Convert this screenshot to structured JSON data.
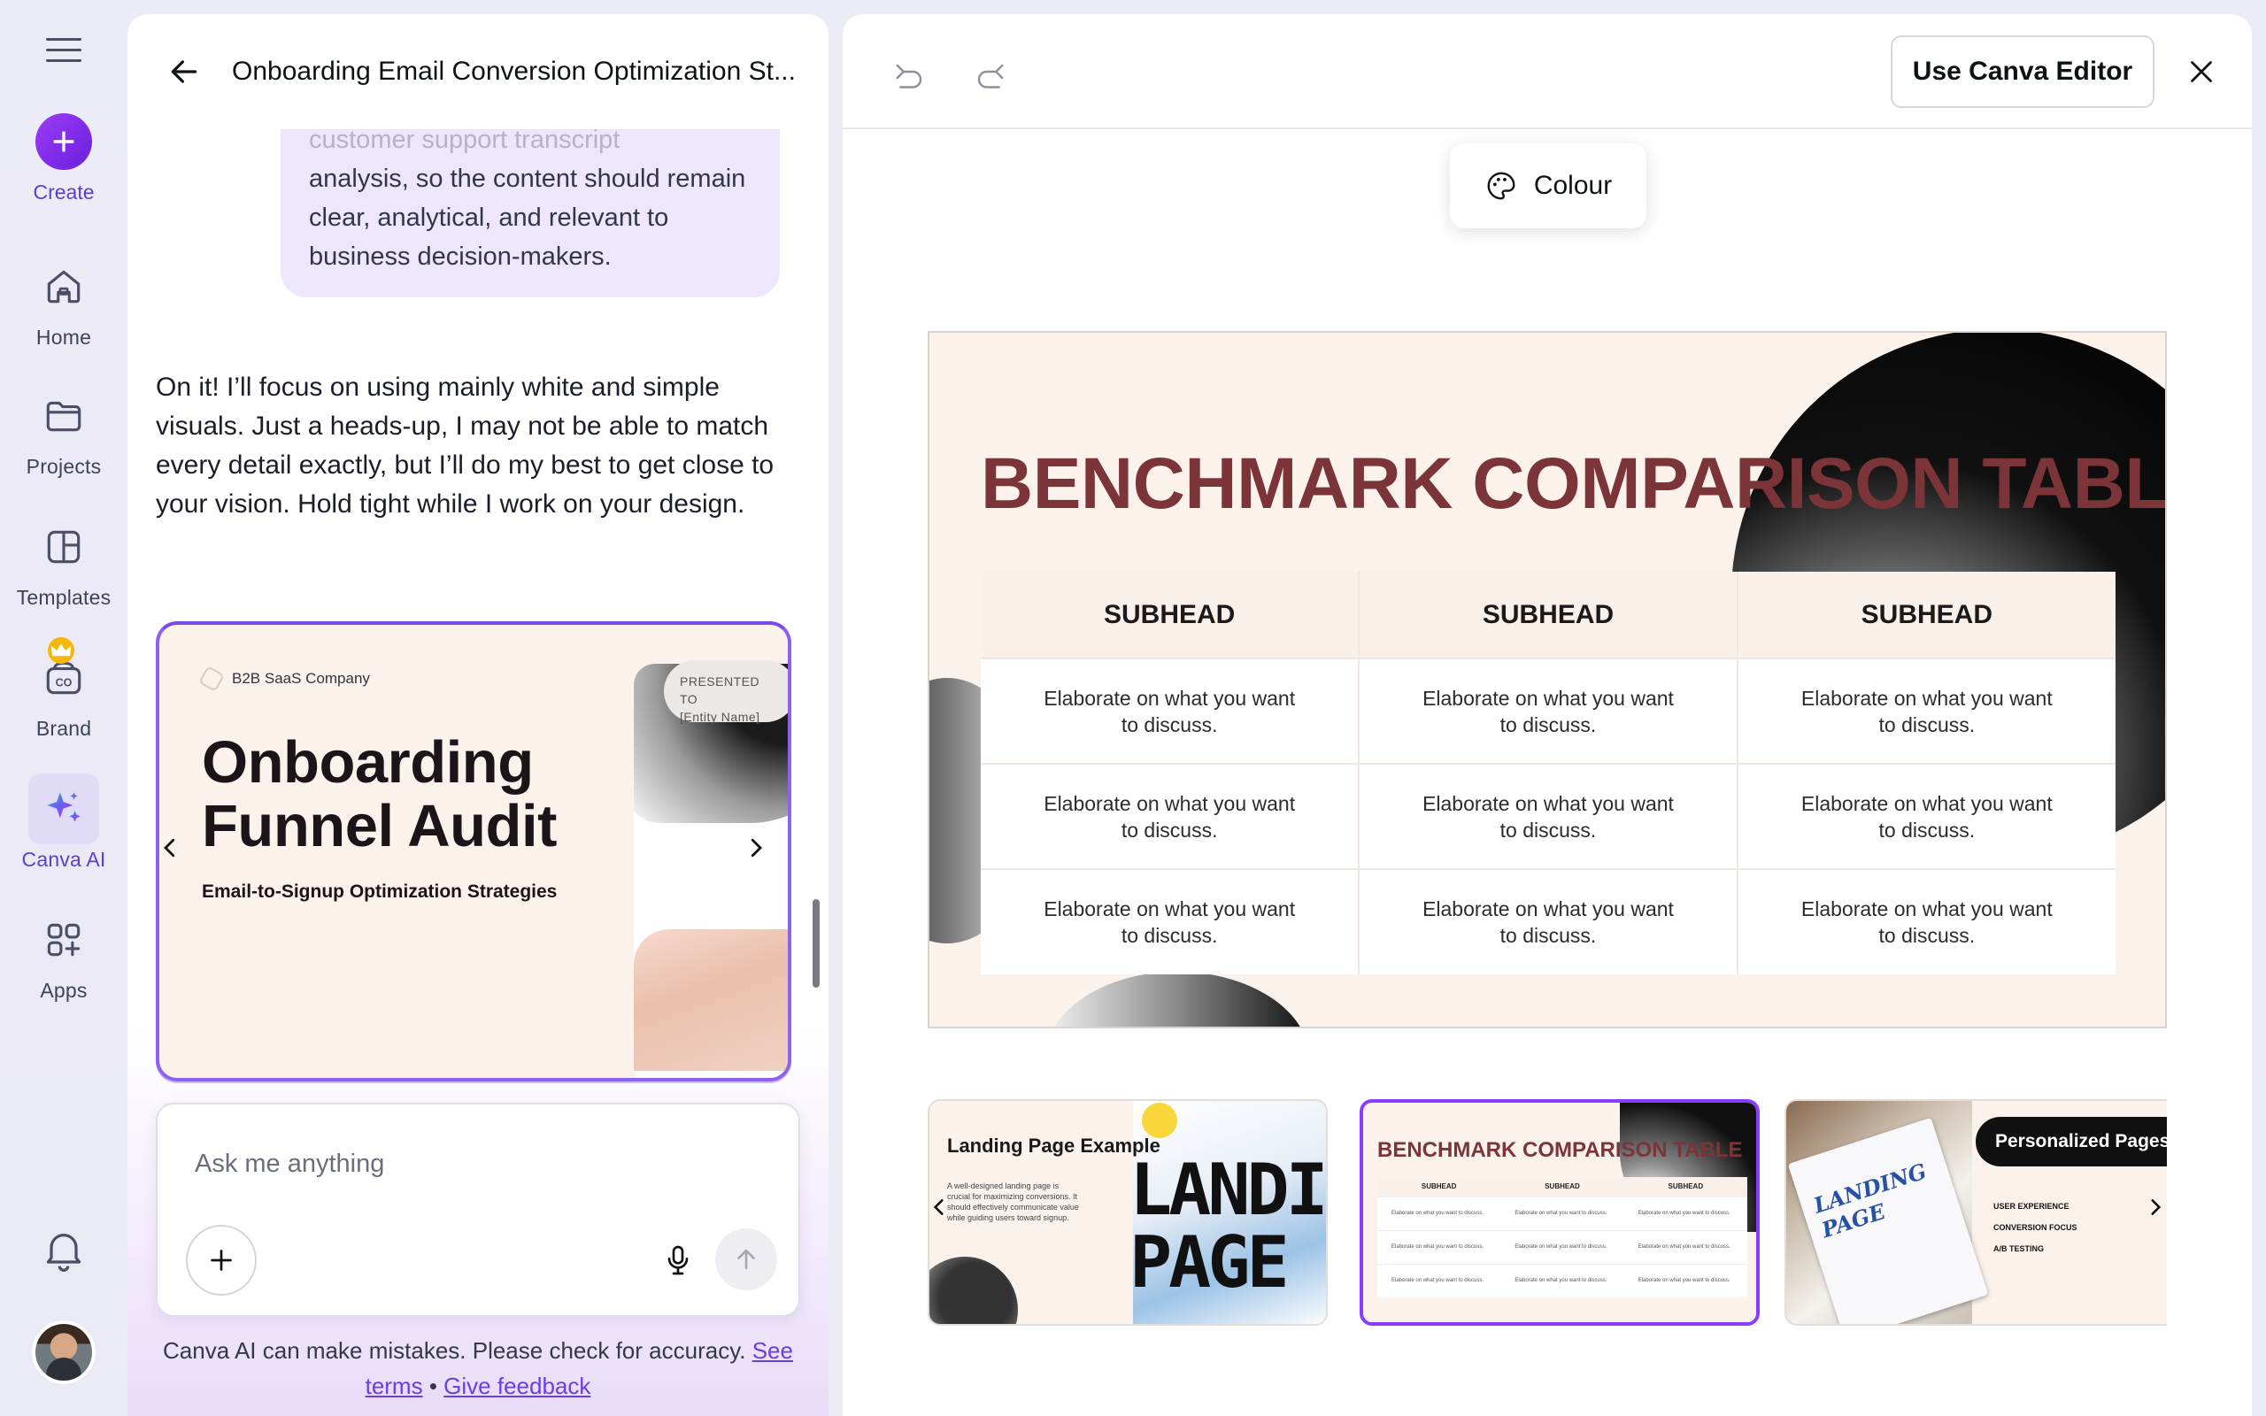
{
  "rail": {
    "create": "Create",
    "items": [
      {
        "label": "Home",
        "icon": "home-icon"
      },
      {
        "label": "Projects",
        "icon": "folder-icon"
      },
      {
        "label": "Templates",
        "icon": "templates-icon"
      },
      {
        "label": "Brand",
        "icon": "brand-icon"
      },
      {
        "label": "Canva AI",
        "icon": "sparkle-icon"
      },
      {
        "label": "Apps",
        "icon": "apps-icon"
      }
    ],
    "active": "Canva AI",
    "accent": "#7d2ae8"
  },
  "chat": {
    "title": "Onboarding Email Conversion Optimization St...",
    "user_message_fade": "customer support transcript",
    "user_message": "analysis, so the content should remain clear, analytical, and relevant to business decision-makers.",
    "ai_message": "On it! I’ll focus on using mainly white and simple visuals. Just a heads-up, I may not be able to match every detail exactly, but I’ll do my best to get close to your vision. Hold tight while I work on your design.",
    "design_card": {
      "company": "B2B SaaS Company",
      "title": "Onboarding Funnel Audit",
      "subtitle": "Email-to-Signup Optimization Strategies",
      "presented_to": "PRESENTED TO",
      "entity": "[Entity Name]"
    },
    "input_placeholder": "Ask me anything",
    "disclaimer": "Canva AI can make mistakes. Please check for accuracy.",
    "see_terms": "See terms",
    "separator": "•",
    "give_feedback": "Give feedback"
  },
  "preview": {
    "use_editor": "Use Canva Editor",
    "colour": "Colour",
    "slide": {
      "title": "BENCHMARK COMPARISON TABLE",
      "headers": [
        "SUBHEAD",
        "SUBHEAD",
        "SUBHEAD"
      ],
      "rows": [
        [
          "Elaborate on what you want to discuss.",
          "Elaborate on what you want to discuss.",
          "Elaborate on what you want to discuss."
        ],
        [
          "Elaborate on what you want to discuss.",
          "Elaborate on what you want to discuss.",
          "Elaborate on what you want to discuss."
        ],
        [
          "Elaborate on what you want to discuss.",
          "Elaborate on what you want to discuss.",
          "Elaborate on what you want to discuss."
        ]
      ],
      "title_color": "#7b3538"
    },
    "thumbnails": [
      {
        "title": "Landing Page Example",
        "body": "A well-designed landing page is crucial for maximizing conversions. It should effectively communicate value while guiding users toward signup.",
        "art": "LANDING PAGE"
      },
      {
        "title": "BENCHMARK COMPARISON TABLE",
        "selected": true,
        "headers": [
          "SUBHEAD",
          "SUBHEAD",
          "SUBHEAD"
        ],
        "cell": "Elaborate on what you want to discuss."
      },
      {
        "title": "Personalized Pages",
        "photo_text": "LANDING PAGE",
        "items": [
          "USER EXPERIENCE",
          "CONVERSION FOCUS",
          "A/B TESTING"
        ]
      }
    ]
  }
}
